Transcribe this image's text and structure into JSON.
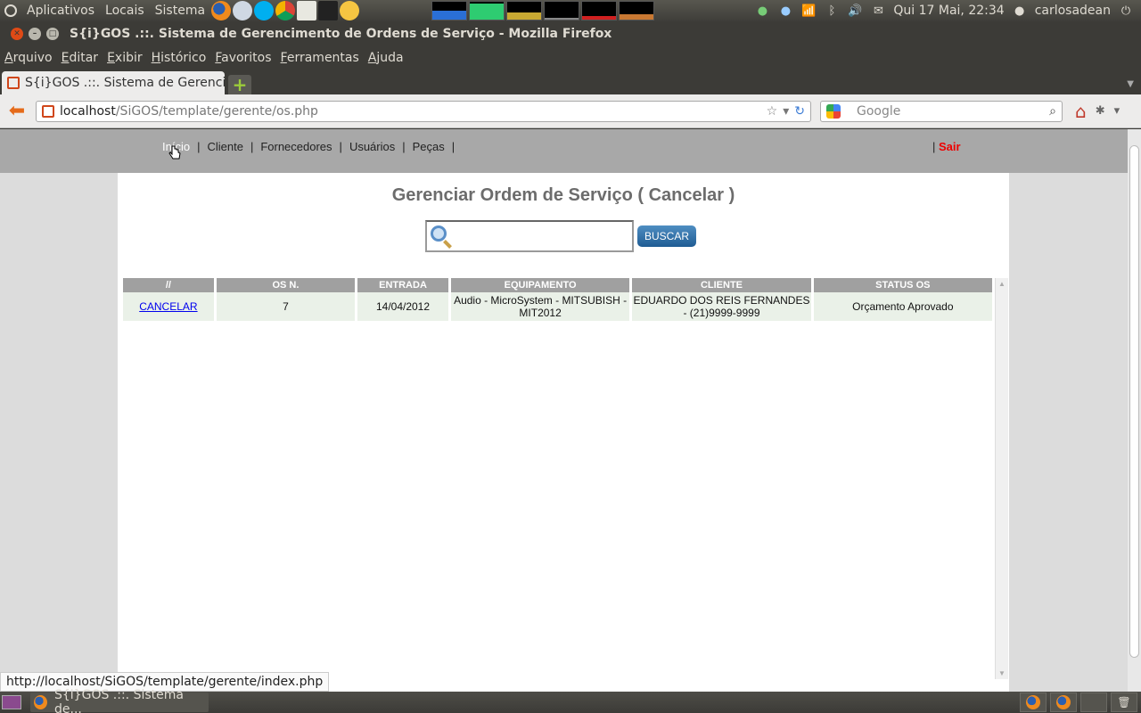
{
  "top_panel": {
    "menus": [
      "Aplicativos",
      "Locais",
      "Sistema"
    ],
    "clock": "Qui 17 Mai, 22:34",
    "user": "carlosadean"
  },
  "window": {
    "title": "S{i}GOS .::. Sistema de Gerencimento de Ordens de Serviço - Mozilla Firefox"
  },
  "menubar": [
    "Arquivo",
    "Editar",
    "Exibir",
    "Histórico",
    "Favoritos",
    "Ferramentas",
    "Ajuda"
  ],
  "tab": {
    "title": "S{i}GOS .::. Sistema de Gerenci..."
  },
  "urlbar": {
    "host": "localhost",
    "path": "/SiGOS/template/gerente/os.php"
  },
  "searchbar": {
    "placeholder": "Google"
  },
  "site_nav": {
    "items": [
      "Início",
      "Cliente",
      "Fornecedores",
      "Usuários",
      "Peças"
    ],
    "separator": "|",
    "logout": "Sair"
  },
  "main": {
    "heading": "Gerenciar Ordem de Serviço ( Cancelar )",
    "search_button": "BUSCAR",
    "table": {
      "headers": [
        "//",
        "OS N.",
        "ENTRADA",
        "EQUIPAMENTO",
        "CLIENTE",
        "STATUS OS"
      ],
      "rows": [
        {
          "action": "CANCELAR",
          "os_number": "7",
          "entrada": "14/04/2012",
          "equipamento": "Audio - MicroSystem - MITSUBISH - MIT2012",
          "cliente": "EDUARDO DOS REIS FERNANDES - (21)9999-9999",
          "status": "Orçamento Aprovado"
        }
      ]
    }
  },
  "status_bar": {
    "url": "http://localhost/SiGOS/template/gerente/index.php"
  },
  "taskbar": {
    "item": "S{i}GOS .::. Sistema de..."
  },
  "colors": {
    "accent_logout": "#ee0000",
    "nav_bg": "#a8a8a8",
    "header_bg": "#a0a0a0",
    "row_bg": "#eaf1e8"
  }
}
